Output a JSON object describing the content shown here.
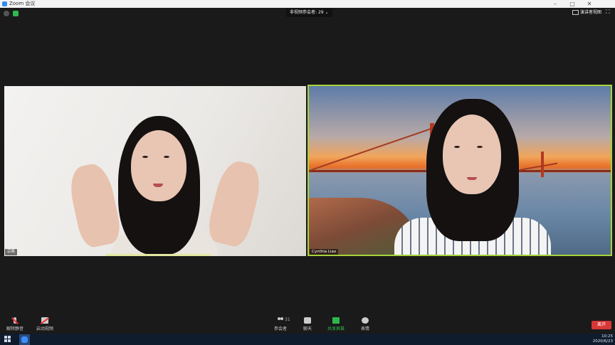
{
  "window": {
    "title": "Zoom 会议"
  },
  "topbar": {
    "participants_label": "非视频参会者:",
    "participants_count": "29",
    "dropdown_glyph": "⌄",
    "view_label": "演讲者视图"
  },
  "tiles": {
    "left_name": "宗燕",
    "right_name": "Cynthia Liao"
  },
  "toolbar": {
    "unmute_label": "解除静音",
    "video_label": "启动视频",
    "participants_label": "参会者",
    "participants_count": "31",
    "chat_label": "聊天",
    "share_label": "共享屏幕",
    "react_label": "表情",
    "leave_label": "离开"
  },
  "taskbar": {
    "time": "10:25",
    "date": "2020/6/23"
  },
  "colors": {
    "active_speaker_border": "#a6d33b",
    "leave_button": "#d93737",
    "share_icon": "#2db84d"
  }
}
